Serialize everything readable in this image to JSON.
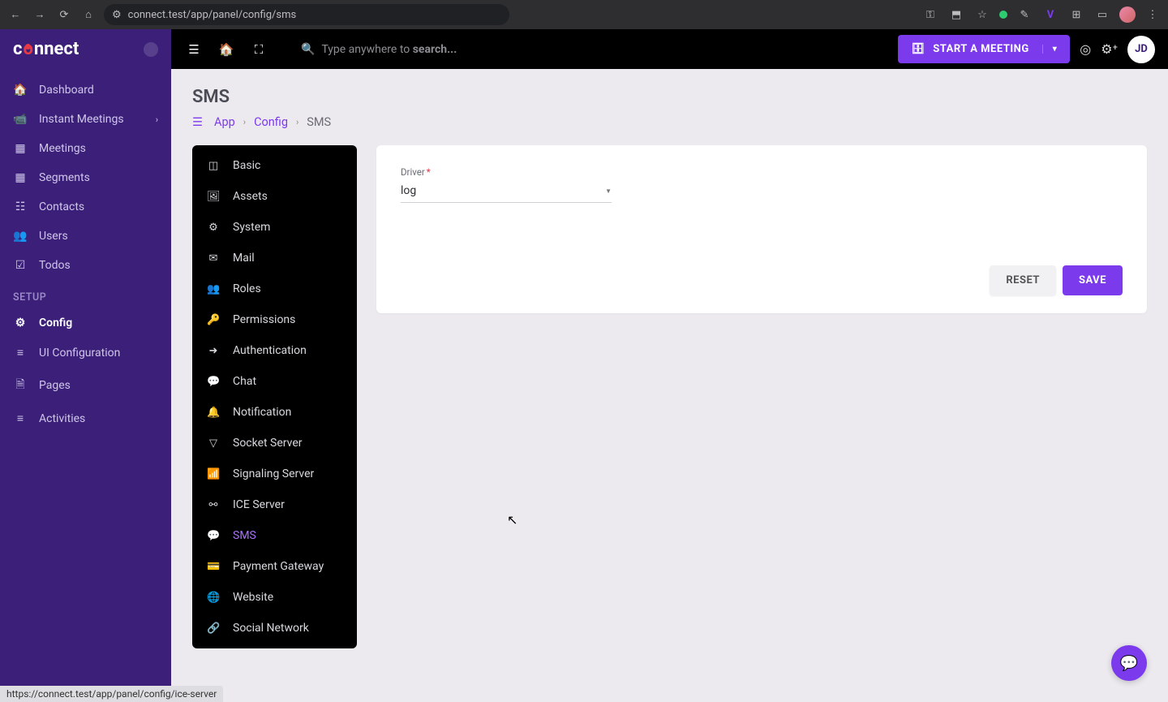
{
  "browser": {
    "url": "connect.test/app/panel/config/sms"
  },
  "brand": {
    "name": "connect"
  },
  "sidebar": {
    "items": [
      {
        "label": "Dashboard",
        "icon": "🏠"
      },
      {
        "label": "Instant Meetings",
        "icon": "📹",
        "expandable": true
      },
      {
        "label": "Meetings",
        "icon": "📅"
      },
      {
        "label": "Segments",
        "icon": "🔲"
      },
      {
        "label": "Contacts",
        "icon": "📇"
      },
      {
        "label": "Users",
        "icon": "👥"
      },
      {
        "label": "Todos",
        "icon": "☑"
      }
    ],
    "section_label": "SETUP",
    "setup_items": [
      {
        "label": "Config",
        "icon": "⚙"
      },
      {
        "label": "UI Configuration",
        "icon": "≡"
      },
      {
        "label": "Pages",
        "icon": "📄"
      },
      {
        "label": "Activities",
        "icon": "≡"
      }
    ]
  },
  "topbar": {
    "search_placeholder_prefix": "Type anywhere to ",
    "search_placeholder_bold": "search...",
    "meeting_btn": "START A MEETING",
    "user_initials": "JD"
  },
  "page": {
    "title": "SMS",
    "breadcrumb": [
      "App",
      "Config",
      "SMS"
    ]
  },
  "config_nav": [
    {
      "label": "Basic",
      "icon": "◫"
    },
    {
      "label": "Assets",
      "icon": "🖼"
    },
    {
      "label": "System",
      "icon": "⚙"
    },
    {
      "label": "Mail",
      "icon": "✉"
    },
    {
      "label": "Roles",
      "icon": "👥"
    },
    {
      "label": "Permissions",
      "icon": "🔑"
    },
    {
      "label": "Authentication",
      "icon": "➜"
    },
    {
      "label": "Chat",
      "icon": "💬"
    },
    {
      "label": "Notification",
      "icon": "🔔"
    },
    {
      "label": "Socket Server",
      "icon": "▽"
    },
    {
      "label": "Signaling Server",
      "icon": "📶"
    },
    {
      "label": "ICE Server",
      "icon": "⚯"
    },
    {
      "label": "SMS",
      "icon": "💬",
      "active": true
    },
    {
      "label": "Payment Gateway",
      "icon": "💳"
    },
    {
      "label": "Website",
      "icon": "🌐"
    },
    {
      "label": "Social Network",
      "icon": "🔗"
    }
  ],
  "form": {
    "driver_label": "Driver",
    "driver_value": "log",
    "reset_label": "RESET",
    "save_label": "SAVE"
  },
  "status_link": "https://connect.test/app/panel/config/ice-server"
}
